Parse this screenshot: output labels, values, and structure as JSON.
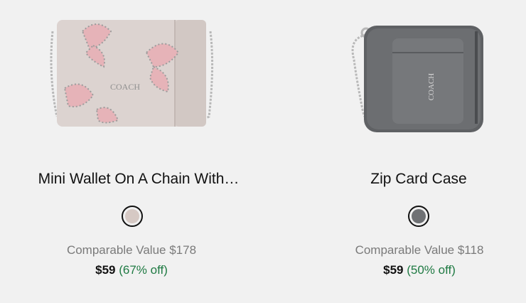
{
  "products": [
    {
      "title": "Mini Wallet On A Chain With…",
      "swatch_color": "#d6c9c4",
      "swatch_name": "chalk",
      "comparable": "Comparable Value $178",
      "price": "$59",
      "discount": "(67% off)"
    },
    {
      "title": "Zip Card Case",
      "swatch_color": "#6f7174",
      "swatch_name": "industrial grey",
      "comparable": "Comparable Value $118",
      "price": "$59",
      "discount": "(50% off)"
    }
  ],
  "colors": {
    "background": "#f1f1f1",
    "discount": "#1f7a43",
    "comparable": "#7a7a7a"
  }
}
